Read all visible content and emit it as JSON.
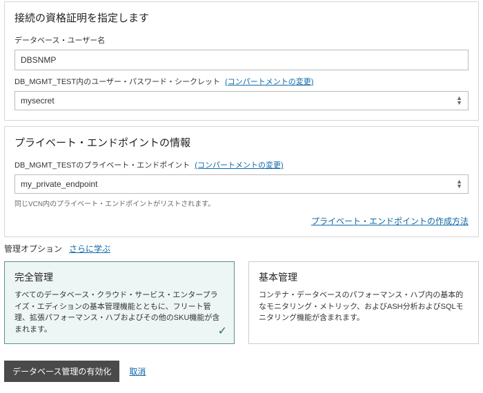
{
  "credentials": {
    "title": "接続の資格証明を指定します",
    "dbUserLabel": "データベース・ユーザー名",
    "dbUserValue": "DBSNMP",
    "secretLabelPrefix": "DB_MGMT_TEST内のユーザー・パスワード・シークレット",
    "changeCompartment": "(コンパートメントの変更)",
    "secretValue": "mysecret"
  },
  "endpoint": {
    "title": "プライベート・エンドポイントの情報",
    "labelPrefix": "DB_MGMT_TESTのプライベート・エンドポイント",
    "changeCompartment": "(コンパートメントの変更)",
    "value": "my_private_endpoint",
    "helper": "同じVCN内のプライベート・エンドポイントがリストされます。",
    "createLink": "プライベート・エンドポイントの作成方法"
  },
  "managementOptions": {
    "label": "管理オプション",
    "learnMore": "さらに学ぶ",
    "full": {
      "title": "完全管理",
      "desc": "すべてのデータベース・クラウド・サービス・エンタープライズ・エディションの基本管理機能とともに、フリート管理、拡張パフォーマンス・ハブおよびその他のSKU機能が含まれます。"
    },
    "basic": {
      "title": "基本管理",
      "desc": "コンテナ・データベースのパフォーマンス・ハブ内の基本的なモニタリング・メトリック、およびASH分析およびSQLモニタリング機能が含まれます。"
    }
  },
  "footer": {
    "enableBtn": "データベース管理の有効化",
    "cancel": "取消"
  }
}
